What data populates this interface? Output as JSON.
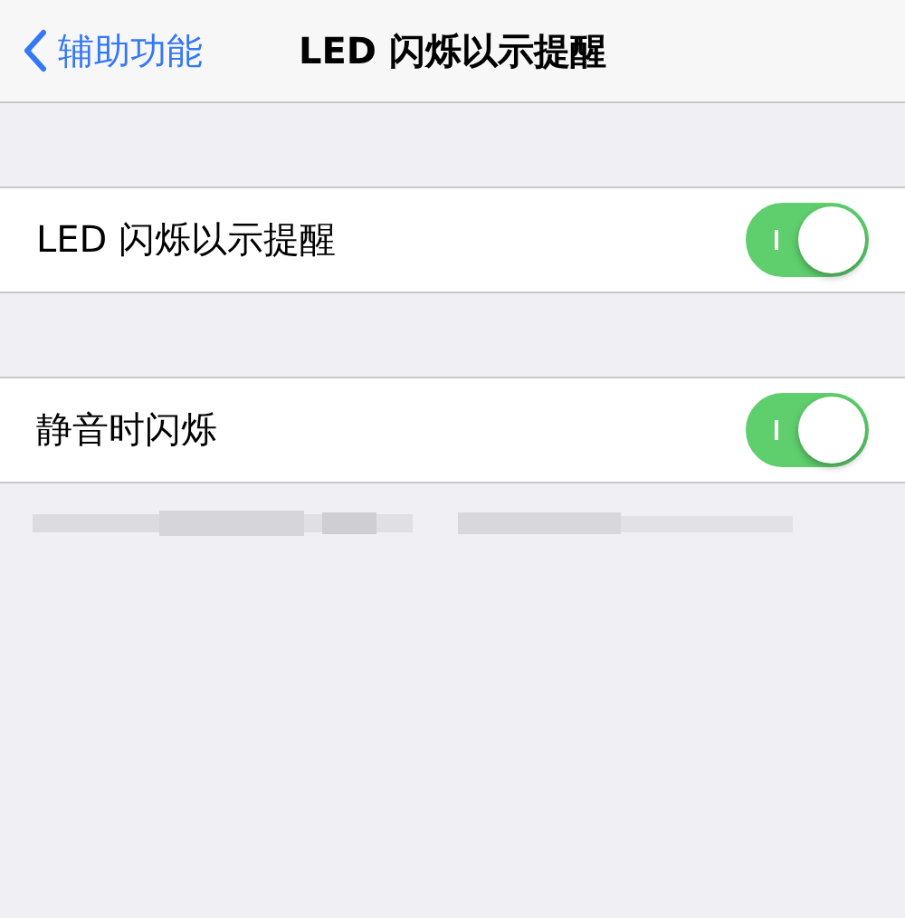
{
  "nav": {
    "back_label": "辅助功能",
    "title": "LED 闪烁以示提醒"
  },
  "sections": [
    {
      "rows": [
        {
          "label": "LED 闪烁以示提醒",
          "on": true
        }
      ]
    },
    {
      "rows": [
        {
          "label": "静音时闪烁",
          "on": true
        }
      ],
      "footer": {
        "kind": "redacted"
      }
    }
  ]
}
